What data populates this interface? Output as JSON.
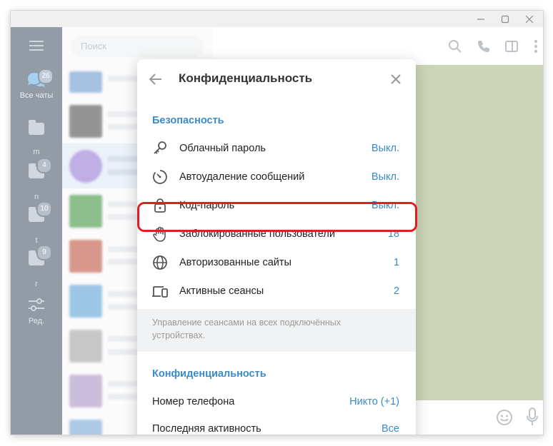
{
  "folders": [
    {
      "label": "Все чаты",
      "badge": "26",
      "icon": "chats-icon"
    },
    {
      "label": "m",
      "badge": "",
      "icon": "folder-icon"
    },
    {
      "label": "n",
      "badge": "4",
      "icon": "folder-icon"
    },
    {
      "label": "t",
      "badge": "10",
      "icon": "folder-icon"
    },
    {
      "label": "r",
      "badge": "9",
      "icon": "folder-icon"
    },
    {
      "label": "Ред.",
      "badge": "",
      "icon": "sliders-icon"
    }
  ],
  "search": {
    "placeholder": "Поиск"
  },
  "modal": {
    "title": "Конфиденциальность",
    "security_section": "Безопасность",
    "security_items": [
      {
        "label": "Облачный пароль",
        "value": "Выкл.",
        "icon": "key-icon"
      },
      {
        "label": "Автоудаление сообщений",
        "value": "Выкл.",
        "icon": "timer-icon"
      },
      {
        "label": "Код-пароль",
        "value": "Выкл.",
        "icon": "lock-icon"
      },
      {
        "label": "Заблокированные пользователи",
        "value": "18",
        "icon": "hand-icon"
      },
      {
        "label": "Авторизованные сайты",
        "value": "1",
        "icon": "globe-icon"
      },
      {
        "label": "Активные сеансы",
        "value": "2",
        "icon": "devices-icon"
      }
    ],
    "sessions_note": "Управление сеансами на всех подключённых устройствах.",
    "privacy_section": "Конфиденциальность",
    "privacy_items": [
      {
        "label": "Номер телефона",
        "value": "Никто (+1)"
      },
      {
        "label": "Последняя активность",
        "value": "Все"
      }
    ]
  },
  "colors": {
    "accent": "#3a8bc9",
    "highlight": "#e02020",
    "sidebar": "#3b4b5d"
  }
}
